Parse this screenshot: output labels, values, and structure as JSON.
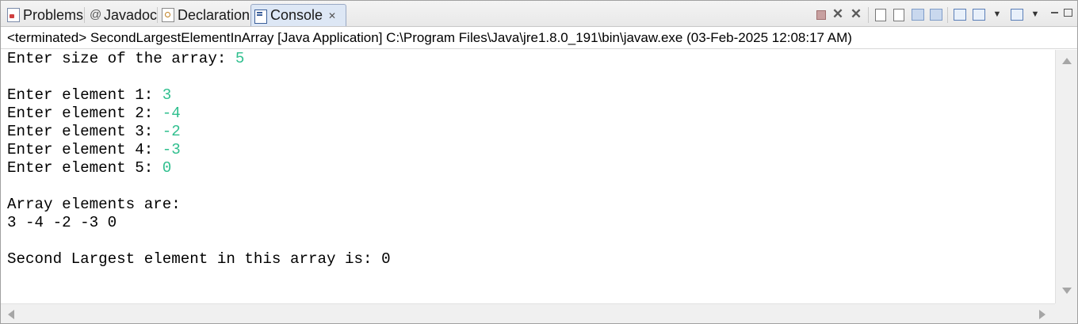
{
  "tabs": [
    {
      "label": "Problems",
      "icon": "problems-icon"
    },
    {
      "label": "Javadoc",
      "icon": "at-icon"
    },
    {
      "label": "Declaration",
      "icon": "declaration-icon"
    },
    {
      "label": "Console",
      "icon": "console-icon",
      "active": true
    }
  ],
  "tab_close_glyph": "✕",
  "header": {
    "text": "<terminated> SecondLargestElementInArray [Java Application] C:\\Program Files\\Java\\jre1.8.0_191\\bin\\javaw.exe (03-Feb-2025 12:08:17 AM)"
  },
  "console": {
    "input_color": "#2fbf8e",
    "lines": [
      {
        "prompt": "Enter size of the array: ",
        "input": "5"
      },
      {
        "prompt": "",
        "input": ""
      },
      {
        "prompt": "Enter element 1: ",
        "input": "3"
      },
      {
        "prompt": "Enter element 2: ",
        "input": "-4"
      },
      {
        "prompt": "Enter element 3: ",
        "input": "-2"
      },
      {
        "prompt": "Enter element 4: ",
        "input": "-3"
      },
      {
        "prompt": "Enter element 5: ",
        "input": "0"
      },
      {
        "prompt": "",
        "input": ""
      },
      {
        "prompt": "Array elements are:",
        "input": ""
      },
      {
        "prompt": "3 -4 -2 -3 0",
        "input": ""
      },
      {
        "prompt": "",
        "input": ""
      },
      {
        "prompt": "Second Largest element in this array is: 0",
        "input": ""
      }
    ]
  },
  "toolbar": [
    "terminate-icon",
    "remove-launch-icon",
    "remove-all-terminated-icon",
    "scroll-lock-icon",
    "word-wrap-icon",
    "show-stdout-icon",
    "show-stderr-icon",
    "pin-console-icon",
    "display-selected-console-icon",
    "open-console-icon",
    "minimize-icon",
    "maximize-icon"
  ]
}
